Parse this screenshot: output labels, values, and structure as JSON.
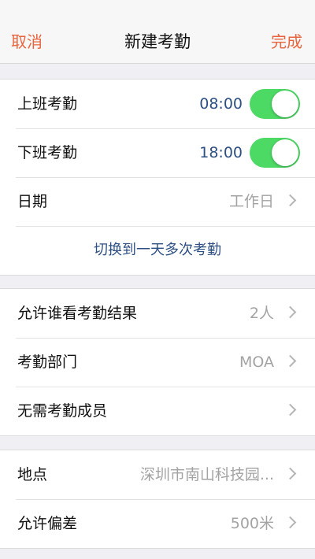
{
  "header": {
    "cancel_label": "取消",
    "title": "新建考勤",
    "done_label": "完成"
  },
  "shift_group": {
    "clock_in": {
      "label": "上班考勤",
      "time": "08:00",
      "enabled": true
    },
    "clock_out": {
      "label": "下班考勤",
      "time": "18:00",
      "enabled": true
    },
    "date": {
      "label": "日期",
      "value": "工作日"
    },
    "switch_link": "切换到一天多次考勤"
  },
  "people_group": {
    "viewers": {
      "label": "允许谁看考勤结果",
      "value": "2人"
    },
    "department": {
      "label": "考勤部门",
      "value": "MOA"
    },
    "exempt": {
      "label": "无需考勤成员",
      "value": ""
    }
  },
  "location_group": {
    "location": {
      "label": "地点",
      "value": "深圳市南山科技园..."
    },
    "tolerance": {
      "label": "允许偏差",
      "value": "500米"
    }
  },
  "colors": {
    "accent": "#e8643c",
    "link": "#2d4f83",
    "toggle_on": "#4cd964",
    "background": "#efeff4"
  },
  "icons": [
    "chevron-right-icon",
    "toggle-switch"
  ]
}
